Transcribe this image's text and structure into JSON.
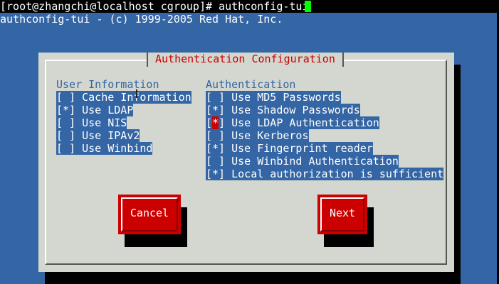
{
  "terminal": {
    "prompt_line": "[root@zhangchi@localhost cgroup]# authconfig-tui",
    "banner_line": "authconfig-tui - (c) 1999-2005 Red Hat, Inc."
  },
  "dialog": {
    "title": "Authentication Configuration",
    "user_info": {
      "label": "User Information",
      "items": [
        {
          "mark": "[ ]",
          "label": "Cache Information",
          "checked": false
        },
        {
          "mark": "[*]",
          "label": "Use LDAP",
          "checked": true
        },
        {
          "mark": "[ ]",
          "label": "Use NIS",
          "checked": false
        },
        {
          "mark": "[ ]",
          "label": "Use IPAv2",
          "checked": false
        },
        {
          "mark": "[ ]",
          "label": "Use Winbind",
          "checked": false
        }
      ]
    },
    "authentication": {
      "label": "Authentication",
      "items": [
        {
          "mark": "[ ]",
          "label": "Use MD5 Passwords",
          "checked": false
        },
        {
          "mark": "[*]",
          "label": "Use Shadow Passwords",
          "checked": true
        },
        {
          "mark": "[*]",
          "label": "Use LDAP Authentication",
          "checked": true
        },
        {
          "mark": "[ ]",
          "label": "Use Kerberos",
          "checked": false
        },
        {
          "mark": "[*]",
          "label": "Use Fingerprint reader",
          "checked": true
        },
        {
          "mark": "[ ]",
          "label": "Use Winbind Authentication",
          "checked": false
        },
        {
          "mark": "[*]",
          "label": "Local authorization is sufficient",
          "checked": true
        }
      ]
    },
    "buttons": {
      "cancel": "Cancel",
      "next": "Next"
    }
  },
  "colors": {
    "background": "#3465a4",
    "dialog": "#d3d7cf",
    "accent_red": "#cc0000",
    "cursor": "#00ff00"
  }
}
